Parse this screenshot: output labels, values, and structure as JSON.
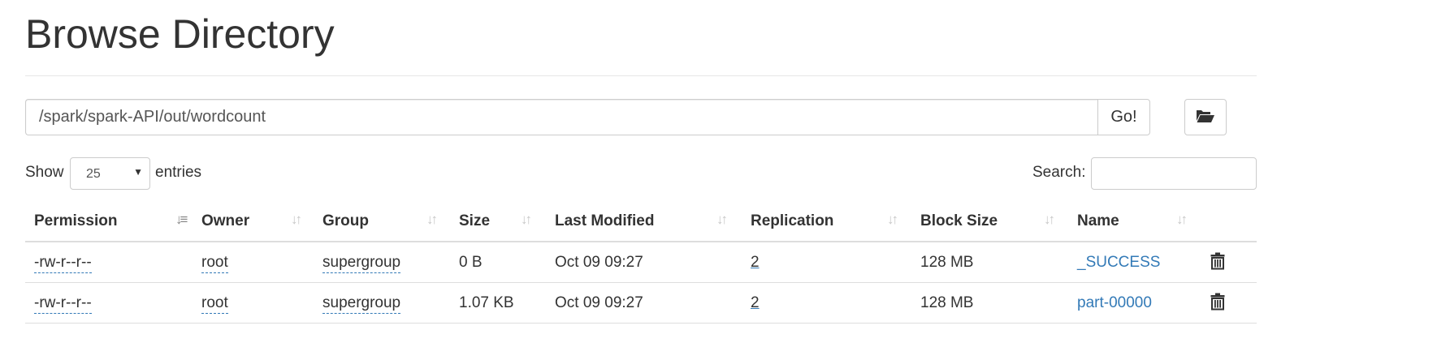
{
  "page": {
    "title": "Browse Directory"
  },
  "path_bar": {
    "value": "/spark/spark-API/out/wordcount",
    "go_label": "Go!",
    "folder_icon": "folder-open-icon"
  },
  "length": {
    "show_label": "Show",
    "selected": "25",
    "entries_label": "entries"
  },
  "search": {
    "label": "Search:",
    "value": ""
  },
  "table": {
    "columns": [
      {
        "label": "Permission",
        "sort": "ascending"
      },
      {
        "label": "Owner",
        "sort": "none"
      },
      {
        "label": "Group",
        "sort": "none"
      },
      {
        "label": "Size",
        "sort": "none"
      },
      {
        "label": "Last Modified",
        "sort": "none"
      },
      {
        "label": "Replication",
        "sort": "none"
      },
      {
        "label": "Block Size",
        "sort": "none"
      },
      {
        "label": "Name",
        "sort": "none"
      }
    ],
    "rows": [
      {
        "permission": "-rw-r--r--",
        "owner": "root",
        "group": "supergroup",
        "size": "0 B",
        "last_modified": "Oct 09 09:27",
        "replication": "2",
        "block_size": "128 MB",
        "name": "_SUCCESS"
      },
      {
        "permission": "-rw-r--r--",
        "owner": "root",
        "group": "supergroup",
        "size": "1.07 KB",
        "last_modified": "Oct 09 09:27",
        "replication": "2",
        "block_size": "128 MB",
        "name": "part-00000"
      }
    ]
  },
  "colors": {
    "link": "#337ab7",
    "text": "#333333",
    "border": "#dddddd"
  }
}
